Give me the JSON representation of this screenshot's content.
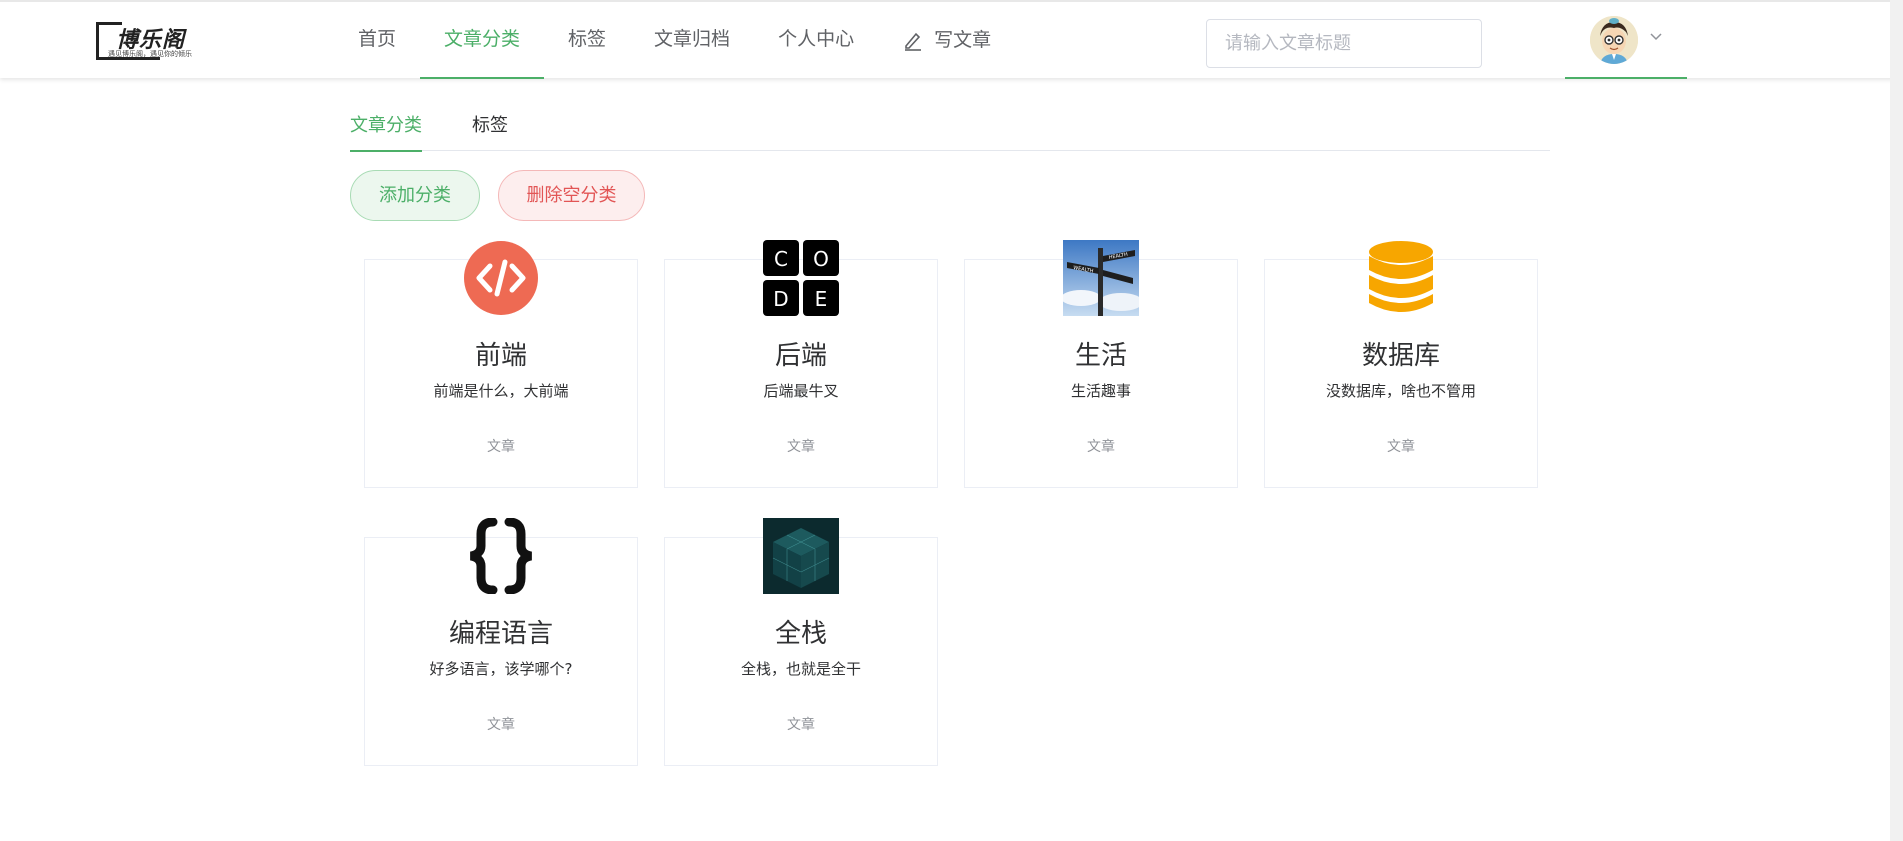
{
  "header": {
    "logo_title": "博乐阁",
    "logo_sub": "遇见博乐阁，遇见你的倾乐",
    "nav": [
      {
        "label": "首页"
      },
      {
        "label": "文章分类"
      },
      {
        "label": "标签"
      },
      {
        "label": "文章归档"
      },
      {
        "label": "个人中心"
      }
    ],
    "write_label": "写文章",
    "search_placeholder": "请输入文章标题",
    "active_color": "#4caf68"
  },
  "subtabs": [
    {
      "label": "文章分类"
    },
    {
      "label": "标签"
    }
  ],
  "actions": {
    "add_label": "添加分类",
    "delete_label": "删除空分类"
  },
  "categories": [
    {
      "name": "前端",
      "desc": "前端是什么，大前端",
      "meta": "文章",
      "icon": "code-brackets-icon"
    },
    {
      "name": "后端",
      "desc": "后端最牛叉",
      "meta": "文章",
      "icon": "code-tiles-icon"
    },
    {
      "name": "生活",
      "desc": "生活趣事",
      "meta": "文章",
      "icon": "signpost-icon"
    },
    {
      "name": "数据库",
      "desc": "没数据库，啥也不管用",
      "meta": "文章",
      "icon": "database-icon"
    },
    {
      "name": "编程语言",
      "desc": "好多语言，该学哪个?",
      "meta": "文章",
      "icon": "curly-braces-icon"
    },
    {
      "name": "全栈",
      "desc": "全栈，也就是全干",
      "meta": "文章",
      "icon": "cube-icon"
    }
  ]
}
